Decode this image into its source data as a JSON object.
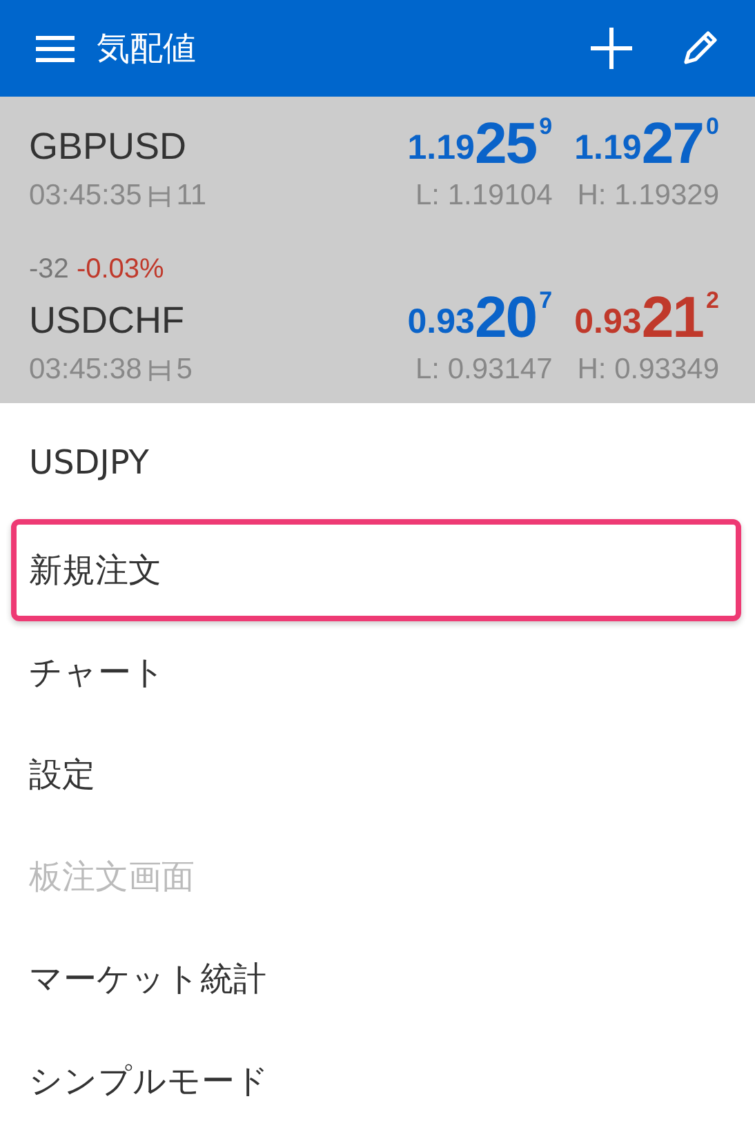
{
  "app_bar": {
    "title": "気配値"
  },
  "quotes": [
    {
      "symbol": "GBPUSD",
      "time": "03:45:35",
      "spread": "11",
      "bid": {
        "prefix": "1.19",
        "big": "25",
        "sup": "9",
        "color": "#0a63c9"
      },
      "ask": {
        "prefix": "1.19",
        "big": "27",
        "sup": "0",
        "color": "#0a63c9"
      },
      "low": "L: 1.19104",
      "high": "H: 1.19329"
    },
    {
      "symbol": "USDCHF",
      "change": {
        "points": "-32",
        "percent": "-0.03%"
      },
      "time": "03:45:38",
      "spread": "5",
      "bid": {
        "prefix": "0.93",
        "big": "20",
        "sup": "7",
        "color": "#0a63c9"
      },
      "ask": {
        "prefix": "0.93",
        "big": "21",
        "sup": "2",
        "color": "#c0392b"
      },
      "low": "L: 0.93147",
      "high": "H: 0.93349"
    }
  ],
  "menu": {
    "items": [
      {
        "label": "USDJPY",
        "disabled": false,
        "highlighted": false
      },
      {
        "label": "新規注文",
        "disabled": false,
        "highlighted": true
      },
      {
        "label": "チャート",
        "disabled": false,
        "highlighted": false
      },
      {
        "label": "設定",
        "disabled": false,
        "highlighted": false
      },
      {
        "label": "板注文画面",
        "disabled": true,
        "highlighted": false
      },
      {
        "label": "マーケット統計",
        "disabled": false,
        "highlighted": false
      },
      {
        "label": "シンプルモード",
        "disabled": false,
        "highlighted": false
      }
    ]
  }
}
